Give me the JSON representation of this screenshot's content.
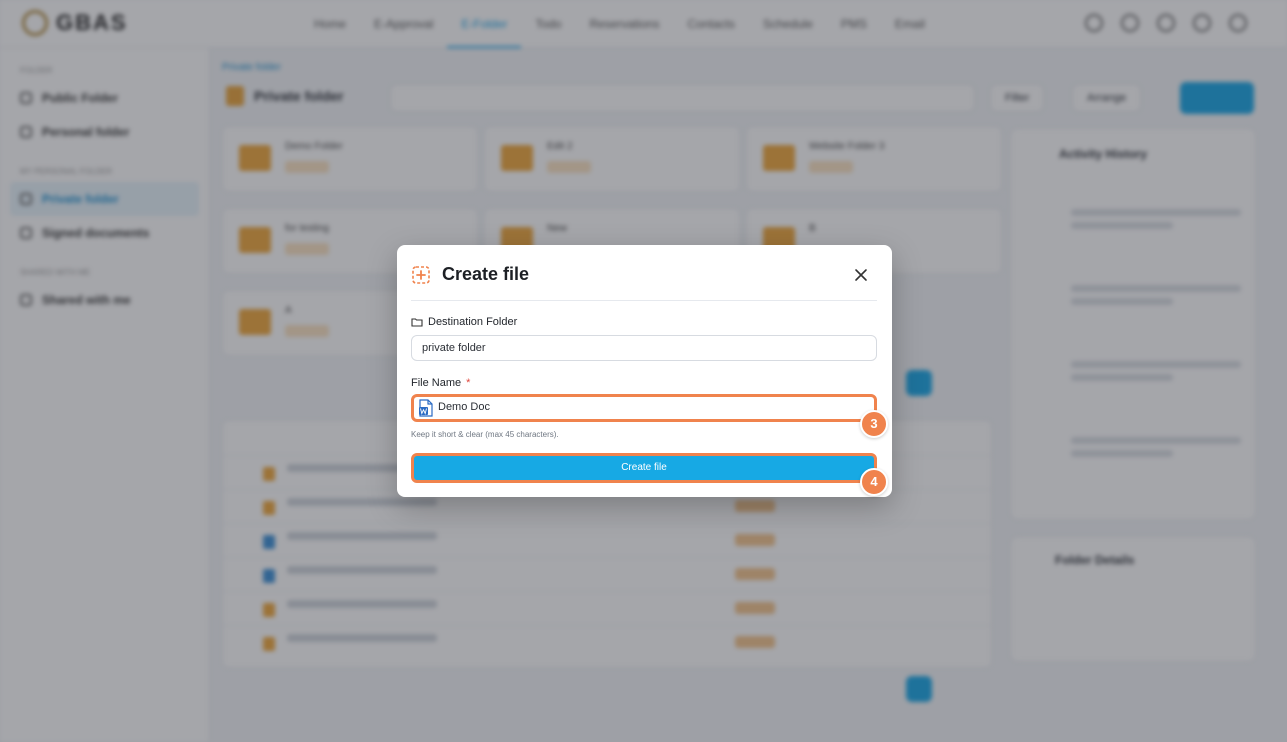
{
  "app": {
    "logo_text": "GBAS",
    "nav": [
      "Home",
      "E-Approval",
      "E-Folder",
      "Todo",
      "Reservations",
      "Contacts",
      "Schedule",
      "PMS",
      "Email"
    ],
    "nav_active": "E-Folder"
  },
  "sidebar": {
    "section_folder": "FOLDER",
    "items_top": [
      "Public Folder",
      "Personal folder"
    ],
    "section_personal": "MY PERSONAL FOLDER",
    "items_personal": [
      "Private folder",
      "Signed documents"
    ],
    "section_shared": "SHARED WITH ME",
    "items_shared": [
      "Shared with me"
    ]
  },
  "main": {
    "breadcrumb": "Private folder",
    "title": "Private folder",
    "filter_label": "Filter",
    "arrange_label": "Arrange",
    "folders": [
      "Demo Folder",
      "Edit 2",
      "Website Folder 3",
      "for testing",
      "New",
      "B",
      "A"
    ]
  },
  "side_panels": {
    "activity_title": "Activity History",
    "stats_title": "Folder Details"
  },
  "modal": {
    "title": "Create file",
    "destination_label": "Destination Folder",
    "destination_value": "private folder",
    "file_name_label": "File Name",
    "required_mark": "*",
    "file_name_value": "Demo Doc",
    "hint": "Keep it short & clear (max 45 characters).",
    "submit_label": "Create file",
    "step_badges": [
      "3",
      "4"
    ]
  },
  "colors": {
    "accent": "#17a9e4",
    "highlight": "#f0834d",
    "folder": "#efa73b"
  }
}
